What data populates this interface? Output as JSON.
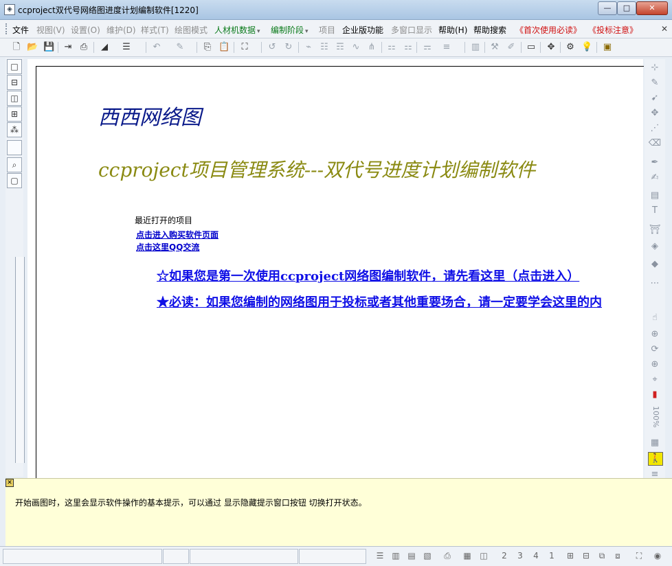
{
  "window": {
    "title": "ccproject双代号网络图进度计划编制软件[1220]",
    "buttons": {
      "minimize": "—",
      "maximize": "□",
      "close": "✕"
    }
  },
  "menu": [
    {
      "label": "文件",
      "state": "normal"
    },
    {
      "label": "视图(V)",
      "state": "disabled"
    },
    {
      "label": "设置(O)",
      "state": "disabled"
    },
    {
      "label": "维护(D)",
      "state": "disabled"
    },
    {
      "label": "样式(T)",
      "state": "disabled"
    },
    {
      "label": "绘图模式",
      "state": "disabled"
    },
    {
      "label": "人材机数据",
      "state": "green"
    },
    {
      "label": "编制阶段",
      "state": "green"
    },
    {
      "label": "项目",
      "state": "disabled"
    },
    {
      "label": "企业版功能",
      "state": "normal"
    },
    {
      "label": "多窗口显示",
      "state": "disabled"
    },
    {
      "label": "帮助(H)",
      "state": "normal"
    },
    {
      "label": "帮助搜索",
      "state": "normal"
    },
    {
      "label": "《首次使用必读》",
      "state": "red"
    },
    {
      "label": "《投标注意》",
      "state": "red"
    }
  ],
  "toolbar_icons": [
    "new-file-icon",
    "open-folder-icon",
    "save-icon",
    "export-icon",
    "print-preview-icon",
    "line-style-icon",
    "indent-icon",
    "undo-icon",
    "brush-icon",
    "copy-icon",
    "paste-icon",
    "find-icon",
    "undo-arrow-icon",
    "redo-arrow-icon",
    "link-icon",
    "align-icon",
    "list-icon",
    "line-chart-icon",
    "tree-icon",
    "network-icon",
    "network2-icon",
    "branch-icon",
    "format-icon",
    "bars-icon",
    "resource-icon",
    "edit-icon",
    "window-icon",
    "move-icon",
    "gear-icon",
    "bulb-icon",
    "folder-lock-icon"
  ],
  "canvas": {
    "heading1": "西西网络图",
    "heading2": "ccproject项目管理系统---双代号进度计划编制软件",
    "recent_label": "最近打开的项目",
    "link_buy": "点击进入购买软件页面",
    "link_qq": "点击这里QQ交流",
    "link_first_use": "☆如果您是第一次使用ccproject网络图编制软件，请先看这里（点击进入）",
    "link_must_read": "★必读：如果您编制的网络图用于投标或者其他重要场合，请一定要学会这里的内"
  },
  "right_panel": {
    "zoom": "100%"
  },
  "hint": {
    "text": "开始画图时，这里会显示软件操作的基本提示，可以通过 显示隐藏提示窗口按钮 切换打开状态。"
  },
  "status": {
    "icons": [
      "view1-icon",
      "view2-icon",
      "view3-icon",
      "view4-icon",
      "print-icon",
      "calendar-icon",
      "layout-icon",
      "two-col-icon",
      "three-col-icon",
      "four-col-icon",
      "one-col-icon",
      "split-icon",
      "arrange-icon",
      "arrange2-icon",
      "fit-icon",
      "target-icon"
    ]
  },
  "colors": {
    "heading1": "#0a1a8a",
    "heading2": "#8a8a12",
    "link": "#1010e6",
    "hint_bg": "#ffffd8"
  }
}
